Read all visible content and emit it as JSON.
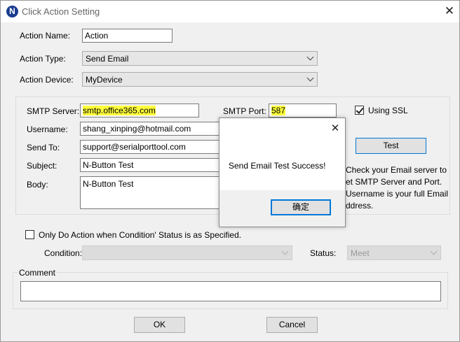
{
  "window": {
    "title": "Click Action Setting",
    "app_icon_letter": "N"
  },
  "action": {
    "name_label": "Action Name:",
    "name_value": "Action",
    "type_label": "Action Type:",
    "type_value": "Send Email",
    "device_label": "Action Device:",
    "device_value": "MyDevice"
  },
  "email": {
    "smtp_server_label": "SMTP Server:",
    "smtp_server_value": "smtp.office365.com",
    "smtp_port_label": "SMTP Port:",
    "smtp_port_value": "587",
    "ssl_label": "Using SSL",
    "ssl_checked": true,
    "username_label": "Username:",
    "username_value": "shang_xinping@hotmail.com",
    "sendto_label": "Send To:",
    "sendto_value": "support@serialporttool.com",
    "test_label": "Test",
    "subject_label": "Subject:",
    "subject_value": "N-Button Test",
    "body_label": "Body:",
    "body_value": "N-Button Test",
    "hint_lines": [
      "Check your Email server to",
      "et SMTP Server and Port.",
      "Username is your full Email",
      "ddress."
    ]
  },
  "condition": {
    "checkbox_label": "Only Do Action when Condition' Status is as Specified.",
    "condition_label": "Condition:",
    "condition_value": "",
    "status_label": "Status:",
    "status_value": "Meet"
  },
  "comment": {
    "label": "Comment",
    "value": ""
  },
  "buttons": {
    "ok": "OK",
    "cancel": "Cancel"
  },
  "dialog": {
    "message": "Send Email Test Success!",
    "confirm": "确定"
  },
  "colors": {
    "highlight": "#ffff3b",
    "focus_border": "#0078d7",
    "icon_bg": "#1b3d8f"
  }
}
